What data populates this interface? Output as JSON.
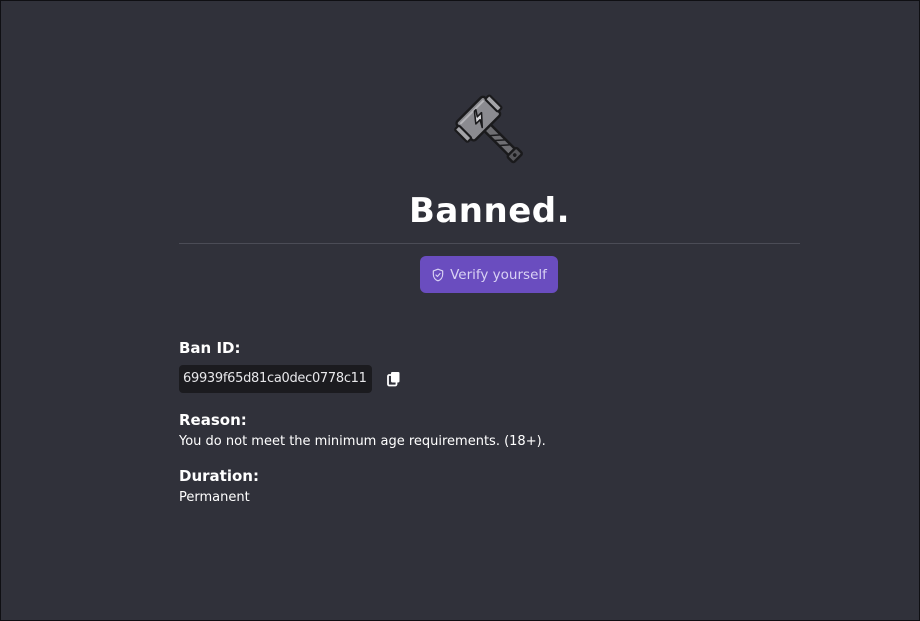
{
  "page": {
    "title": "Banned.",
    "verify_button_label": "Verify yourself",
    "icons": {
      "hero": "hammer-icon",
      "verify": "shield-check-icon",
      "copy": "copy-icon"
    }
  },
  "ban": {
    "id_label": "Ban ID:",
    "id_value": "69939f65d81ca0dec0778c11",
    "reason_label": "Reason:",
    "reason_value": "You do not meet the minimum age requirements. (18+).",
    "duration_label": "Duration:",
    "duration_value": "Permanent"
  },
  "colors": {
    "background": "#30313a",
    "accent": "#6a4dbf",
    "divider": "#4b4c56",
    "code_background": "#1b1b1f"
  }
}
